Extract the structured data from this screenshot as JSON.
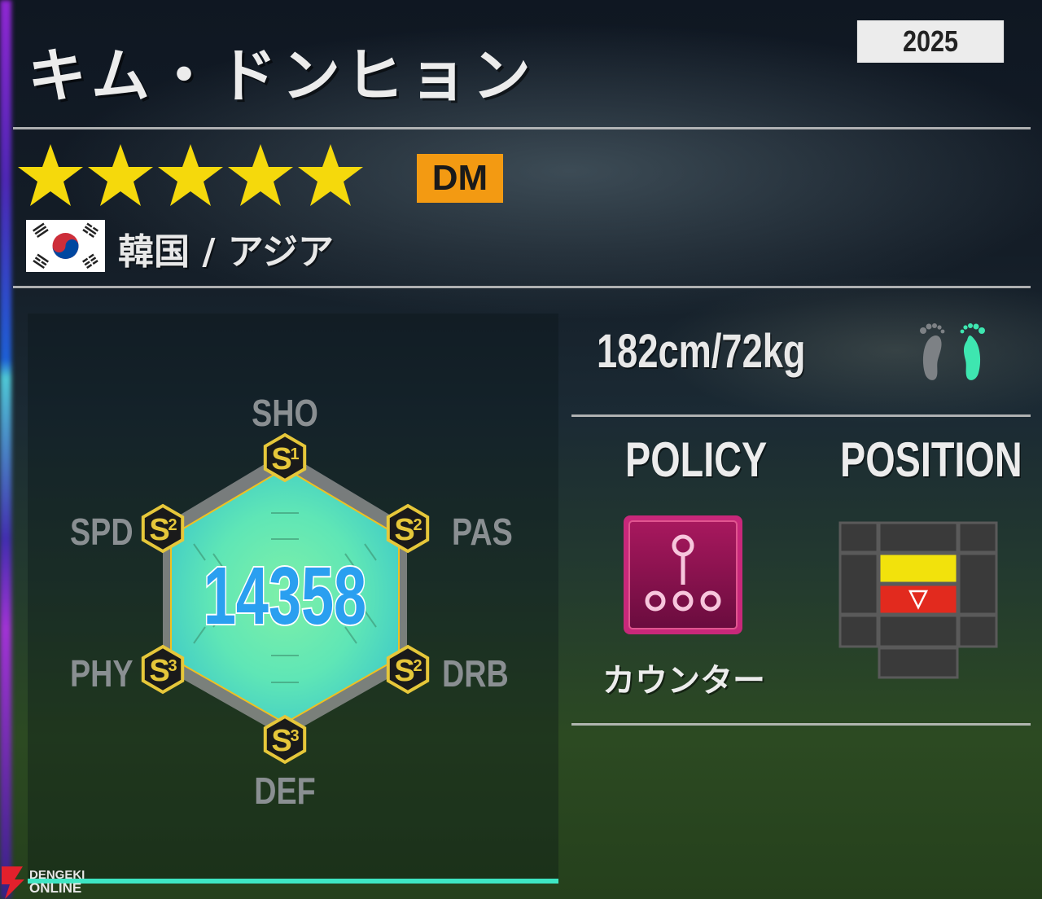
{
  "player": {
    "name": "キム・ドンヒョン",
    "year": "2025",
    "stars": 5,
    "position": "DM",
    "nation": "韓国 / アジア",
    "height_weight": "182cm/72kg",
    "preferred_foot": "right"
  },
  "stats": {
    "total": "14358",
    "labels": {
      "sho": "SHO",
      "pas": "PAS",
      "drb": "DRB",
      "def": "DEF",
      "phy": "PHY",
      "spd": "SPD"
    },
    "grades": {
      "sho": {
        "letter": "S",
        "num": "1"
      },
      "pas": {
        "letter": "S",
        "num": "2"
      },
      "drb": {
        "letter": "S",
        "num": "2"
      },
      "def": {
        "letter": "S",
        "num": "3"
      },
      "phy": {
        "letter": "S",
        "num": "3"
      },
      "spd": {
        "letter": "S",
        "num": "2"
      }
    }
  },
  "policy": {
    "heading": "POLICY",
    "name": "カウンター",
    "icon": "counter-formation-icon",
    "color": "#8a1050"
  },
  "position_map": {
    "heading": "POSITION",
    "primary_color": "#f2e20c",
    "secondary_color": "#e22a1e"
  },
  "colors": {
    "accent": "#3ee6c4",
    "badge": "#f39a12",
    "star": "#f5d90c",
    "grade_gold": "#e6c73a"
  },
  "watermark": {
    "line1": "DENGEKI",
    "line2": "ONLINE"
  }
}
